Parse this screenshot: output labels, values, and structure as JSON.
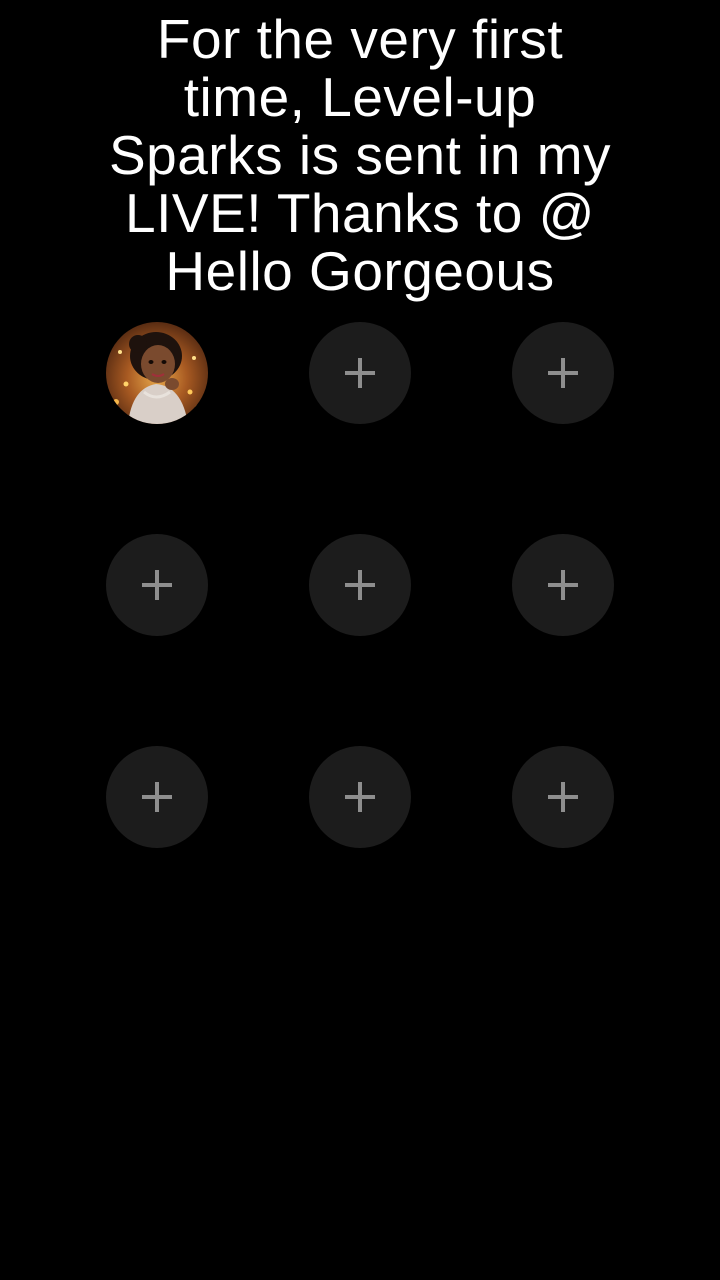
{
  "headline": {
    "line1": "For the very first",
    "line2": "time, Level-up",
    "line3": "Sparks is sent in my",
    "line4": "LIVE! Thanks to @",
    "line5": "Hello Gorgeous"
  },
  "slots": [
    {
      "filled": true,
      "icon": "avatar"
    },
    {
      "filled": false,
      "icon": "plus-icon"
    },
    {
      "filled": false,
      "icon": "plus-icon"
    },
    {
      "filled": false,
      "icon": "plus-icon"
    },
    {
      "filled": false,
      "icon": "plus-icon"
    },
    {
      "filled": false,
      "icon": "plus-icon"
    },
    {
      "filled": false,
      "icon": "plus-icon"
    },
    {
      "filled": false,
      "icon": "plus-icon"
    },
    {
      "filled": false,
      "icon": "plus-icon"
    }
  ],
  "colors": {
    "background": "#000000",
    "text": "#ffffff",
    "slot_fill": "#1c1c1c",
    "plus": "#8e8e8e"
  }
}
